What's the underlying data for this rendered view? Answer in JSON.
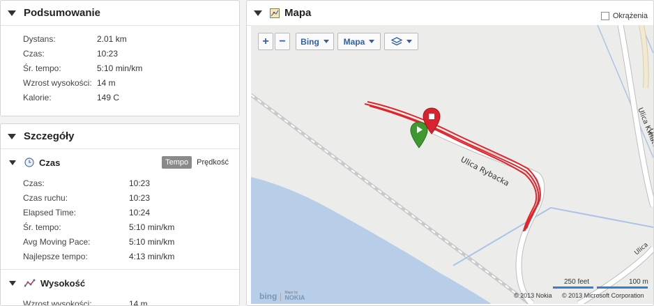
{
  "summary": {
    "title": "Podsumowanie",
    "rows": [
      {
        "label": "Dystans:",
        "value": "2.01 km"
      },
      {
        "label": "Czas:",
        "value": "10:23"
      },
      {
        "label": "Śr. tempo:",
        "value": "5:10 min/km"
      },
      {
        "label": "Wzrost wysokości:",
        "value": "14 m"
      },
      {
        "label": "Kalorie:",
        "value": "149 C"
      }
    ]
  },
  "details": {
    "title": "Szczegóły",
    "time": {
      "title": "Czas",
      "toggle_on": "Tempo",
      "toggle_off": "Prędkość",
      "rows": [
        {
          "label": "Czas:",
          "value": "10:23"
        },
        {
          "label": "Czas ruchu:",
          "value": "10:23"
        },
        {
          "label": "Elapsed Time:",
          "value": "10:24"
        },
        {
          "label": "Śr. tempo:",
          "value": "5:10 min/km"
        },
        {
          "label": "Avg Moving Pace:",
          "value": "5:10 min/km"
        },
        {
          "label": "Najlepsze tempo:",
          "value": "4:13 min/km"
        }
      ]
    },
    "elevation": {
      "title": "Wysokość",
      "rows": [
        {
          "label": "Wzrost wysokości:",
          "value": "14 m"
        }
      ]
    }
  },
  "map": {
    "title": "Mapa",
    "laps_label": "Okrążenia",
    "zoom_in": "+",
    "zoom_out": "−",
    "provider_label": "Bing",
    "maptype_label": "Mapa",
    "street_labels": [
      "Ulica Rybacka",
      "Ulica Kwiatowa",
      "Ulica Skarp"
    ],
    "scale_feet": "250 feet",
    "scale_m": "100 m",
    "copyright_nokia": "© 2013 Nokia",
    "copyright_ms": "© 2013 Microsoft Corporation",
    "bing_logo": "bing",
    "nokia_logo": "NOKIA",
    "nokia_small": "Maps by",
    "colors": {
      "water": "#b7cde8",
      "route": "#e0242b",
      "start": "#3e9a2e",
      "finish": "#d8232f",
      "road": "#ffffff"
    }
  }
}
